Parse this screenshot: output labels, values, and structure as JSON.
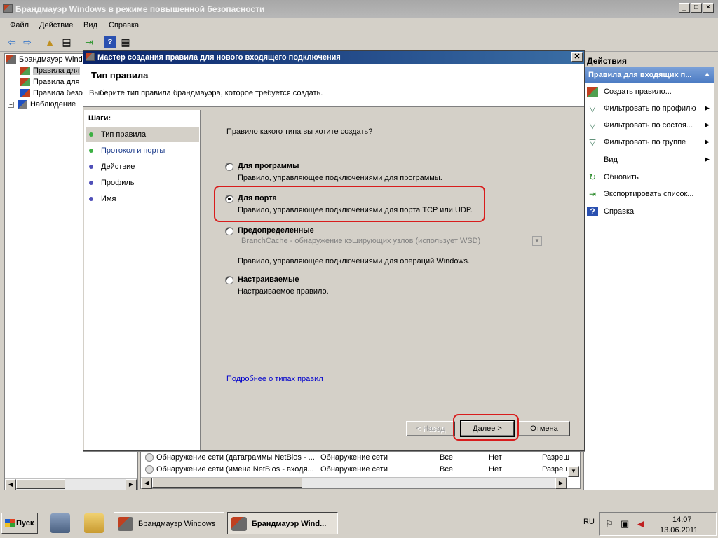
{
  "main_window": {
    "title": "Брандмауэр Windows в режиме повышенной безопасности",
    "menu": [
      "Файл",
      "Действие",
      "Вид",
      "Справка"
    ]
  },
  "tree": {
    "items": [
      {
        "label": "Брандмауэр Windo",
        "icon": "firewall-icon"
      },
      {
        "label": "Правила для",
        "icon": "inbound-rules-icon"
      },
      {
        "label": "Правила для",
        "icon": "outbound-rules-icon"
      },
      {
        "label": "Правила безо",
        "icon": "security-rules-icon"
      },
      {
        "label": "Наблюдение",
        "icon": "monitoring-icon"
      }
    ]
  },
  "rules_list": {
    "rows": [
      {
        "name": "Обнаружение сети (датаграммы NetBios - ...",
        "group": "Обнаружение сети",
        "profile": "Все",
        "enabled": "Нет",
        "action": "Разреш"
      },
      {
        "name": "Обнаружение сети (имена NetBios - входя...",
        "group": "Обнаружение сети",
        "profile": "Все",
        "enabled": "Нет",
        "action": "Разреш"
      }
    ]
  },
  "actions": {
    "title": "Действия",
    "section": "Правила для входящих п...",
    "items": [
      {
        "label": "Создать правило...",
        "icon": "new-rule-icon",
        "submenu": false
      },
      {
        "label": "Фильтровать по профилю",
        "icon": "filter-icon",
        "submenu": true
      },
      {
        "label": "Фильтровать по состоя...",
        "icon": "filter-icon",
        "submenu": true
      },
      {
        "label": "Фильтровать по группе",
        "icon": "filter-icon",
        "submenu": true
      },
      {
        "label": "Вид",
        "icon": "",
        "submenu": true
      },
      {
        "label": "Обновить",
        "icon": "refresh-icon",
        "submenu": false
      },
      {
        "label": "Экспортировать список...",
        "icon": "export-icon",
        "submenu": false
      },
      {
        "label": "Справка",
        "icon": "help-icon",
        "submenu": false
      }
    ]
  },
  "dialog": {
    "title": "Мастер создания правила для нового входящего подключения",
    "heading": "Тип правила",
    "subtitle": "Выберите тип правила брандмауэра, которое требуется создать.",
    "steps_title": "Шаги:",
    "steps": [
      {
        "label": "Тип правила",
        "current": true,
        "color": "#3cb043"
      },
      {
        "label": "Протокол и порты",
        "current": false,
        "color": "#3cb043"
      },
      {
        "label": "Действие",
        "current": false,
        "color": "#5050b8"
      },
      {
        "label": "Профиль",
        "current": false,
        "color": "#5050b8"
      },
      {
        "label": "Имя",
        "current": false,
        "color": "#5050b8"
      }
    ],
    "question": "Правило какого типа вы хотите создать?",
    "options": [
      {
        "label": "Для программы",
        "desc": "Правило, управляющее подключениями для программы.",
        "selected": false
      },
      {
        "label": "Для порта",
        "desc": "Правило, управляющее подключениями для порта TCP или UDP.",
        "selected": true
      },
      {
        "label": "Предопределенные",
        "desc": "Правило, управляющее подключениями для операций Windows.",
        "selected": false
      },
      {
        "label": "Настраиваемые",
        "desc": "Настраиваемое правило.",
        "selected": false
      }
    ],
    "predefined_select": "BranchCache - обнаружение кэширующих узлов (использует WSD)",
    "learn_more": "Подробнее о типах правил",
    "buttons": {
      "back": "< Назад",
      "next": "Далее >",
      "cancel": "Отмена"
    }
  },
  "taskbar": {
    "start": "Пуск",
    "tasks": [
      {
        "label": "Брандмауэр Windows",
        "active": false
      },
      {
        "label": "Брандмауэр Wind...",
        "active": true
      }
    ],
    "language": "RU",
    "time": "14:07",
    "date": "13.06.2011"
  },
  "colors": {
    "highlight_ring": "#d81c1c",
    "dialog_title": "#0a246a",
    "actions_section": "#4c7cc4"
  }
}
